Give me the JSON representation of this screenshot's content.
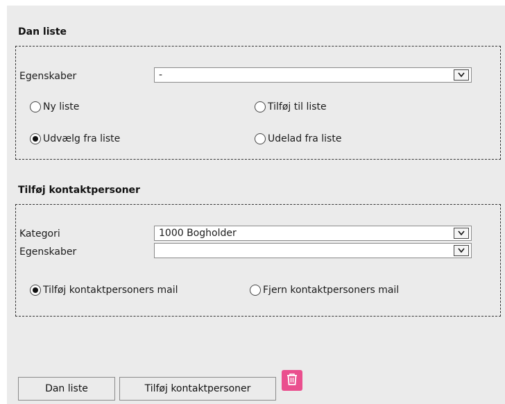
{
  "dan_liste": {
    "title": "Dan liste",
    "egenskaber_label": "Egenskaber",
    "egenskaber_value": "-",
    "radios": {
      "ny_liste": "Ny liste",
      "tilfoj_til_liste": "Tilføj til liste",
      "udvaelg_fra_liste": "Udvælg fra liste",
      "udelad_fra_liste": "Udelad fra liste"
    },
    "selected_radio": "udvaelg_fra_liste"
  },
  "tilfoj_kontaktpersoner": {
    "title": "Tilføj kontaktpersoner",
    "kategori_label": "Kategori",
    "kategori_value": "1000 Bogholder",
    "egenskaber_label": "Egenskaber",
    "egenskaber_value": "",
    "radios": {
      "tilfoj_mail": "Tilføj kontaktpersoners mail",
      "fjern_mail": "Fjern kontaktpersoners mail"
    },
    "selected_radio": "tilfoj_mail"
  },
  "buttons": {
    "dan_liste": "Dan liste",
    "tilfoj_kontaktpersoner": "Tilføj kontaktpersoner",
    "delete_icon": "trash-icon"
  },
  "colors": {
    "panel_bg": "#ebebeb",
    "delete_bg": "#ea4f8e"
  }
}
